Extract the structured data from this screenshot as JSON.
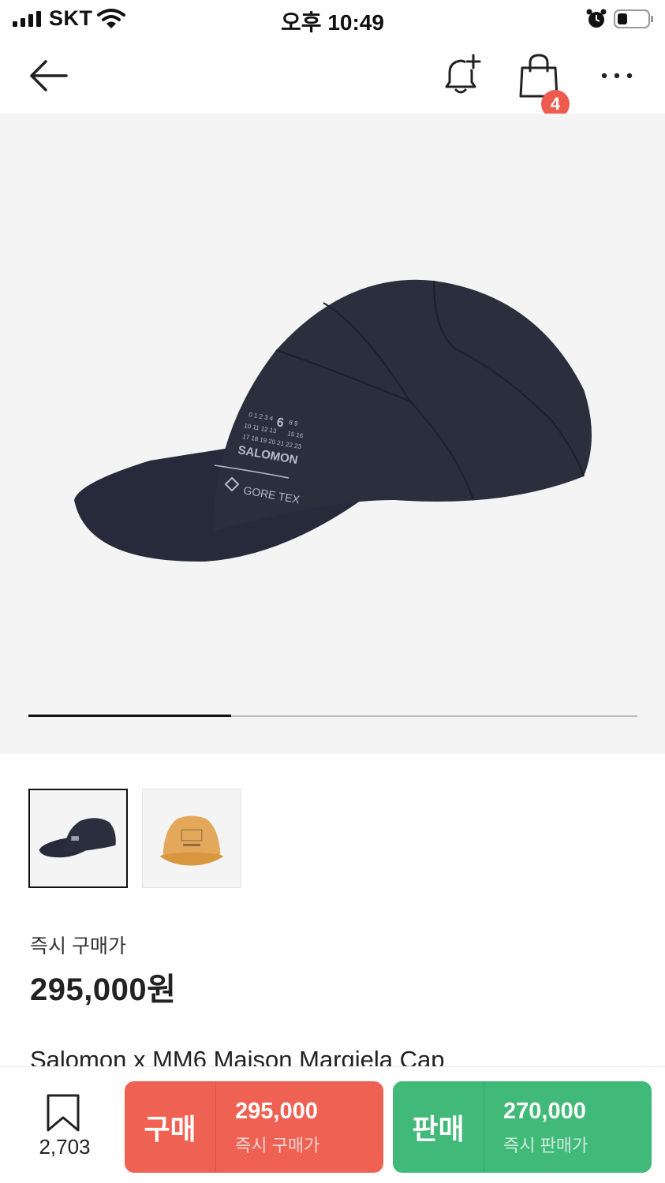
{
  "status_bar": {
    "carrier": "SKT",
    "time": "오후 10:49",
    "icons": [
      "signal-icon",
      "wifi-icon",
      "alarm-icon",
      "battery-icon"
    ]
  },
  "nav": {
    "icons": [
      "back-arrow-icon",
      "bell-plus-icon",
      "shopping-bag-icon",
      "more-dots-icon"
    ],
    "cart_badge": "4"
  },
  "gallery": {
    "progress_fraction": 0.333,
    "thumbnails": [
      {
        "name": "black-cap-thumbnail",
        "selected": true
      },
      {
        "name": "tan-cap-thumbnail",
        "selected": false
      }
    ]
  },
  "hero_print": {
    "brand": "SALOMON",
    "fabric": "GORE TEX",
    "numbers_row1": "0 1 2 3 4",
    "numbers_row1_tail": "8 9",
    "numbers_row2": "10 11 12 13",
    "numbers_row2_tail": "15 16",
    "numbers_row3": "17 18 19 20 21 22 23",
    "big_number": "6"
  },
  "price": {
    "label": "즉시 구매가",
    "value": "295,000원"
  },
  "product": {
    "name": "Salomon x MM6 Maison Margiela Cap"
  },
  "bottom_bar": {
    "bookmark_count": "2,703",
    "buy": {
      "label": "구매",
      "price": "295,000",
      "sub": "즉시 구매가"
    },
    "sell": {
      "label": "판매",
      "price": "270,000",
      "sub": "즉시 판매가"
    }
  },
  "colors": {
    "buy": "#ef6253",
    "sell": "#41b979",
    "badge": "#ef5b4f",
    "hero_bg": "#f4f4f4",
    "cap_navy": "#262a3a",
    "cap_tan": "#e3a85a"
  }
}
